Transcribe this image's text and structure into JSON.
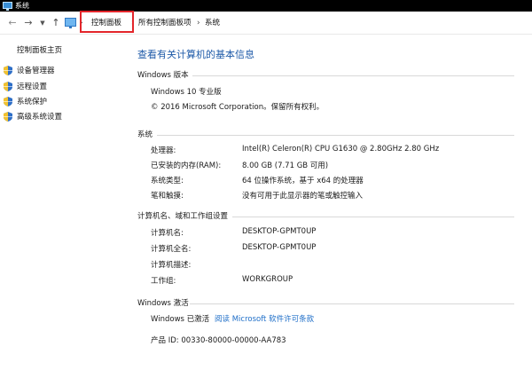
{
  "window": {
    "title": "系统"
  },
  "breadcrumb": {
    "items": [
      "控制面板",
      "所有控制面板项",
      "系统"
    ]
  },
  "sidebar": {
    "home": "控制面板主页",
    "links": [
      {
        "label": "设备管理器",
        "icon": "shield-icon"
      },
      {
        "label": "远程设置",
        "icon": "shield-icon"
      },
      {
        "label": "系统保护",
        "icon": "shield-icon"
      },
      {
        "label": "高级系统设置",
        "icon": "shield-icon"
      }
    ]
  },
  "main": {
    "title": "查看有关计算机的基本信息",
    "edition": {
      "header": "Windows 版本",
      "name": "Windows 10 专业版",
      "copyright": "© 2016 Microsoft Corporation。保留所有权利。"
    },
    "system": {
      "header": "系统",
      "rows": [
        {
          "label": "处理器:",
          "value": "Intel(R) Celeron(R) CPU G1630 @ 2.80GHz   2.80 GHz"
        },
        {
          "label": "已安装的内存(RAM):",
          "value": "8.00 GB (7.71 GB 可用)"
        },
        {
          "label": "系统类型:",
          "value": "64 位操作系统，基于 x64 的处理器"
        },
        {
          "label": "笔和触摸:",
          "value": "没有可用于此显示器的笔或触控输入"
        }
      ]
    },
    "computer": {
      "header": "计算机名、域和工作组设置",
      "rows": [
        {
          "label": "计算机名:",
          "value": "DESKTOP-GPMT0UP"
        },
        {
          "label": "计算机全名:",
          "value": "DESKTOP-GPMT0UP"
        },
        {
          "label": "计算机描述:",
          "value": ""
        },
        {
          "label": "工作组:",
          "value": "WORKGROUP"
        }
      ]
    },
    "activation": {
      "header": "Windows 激活",
      "status": "Windows 已激活",
      "license_link": "阅读 Microsoft 软件许可条款",
      "product_id": "产品 ID: 00330-80000-00000-AA783"
    }
  },
  "colors": {
    "title_blue": "#1e5aa8",
    "link_blue": "#1e6ec8",
    "highlight_red": "#e3262b"
  }
}
